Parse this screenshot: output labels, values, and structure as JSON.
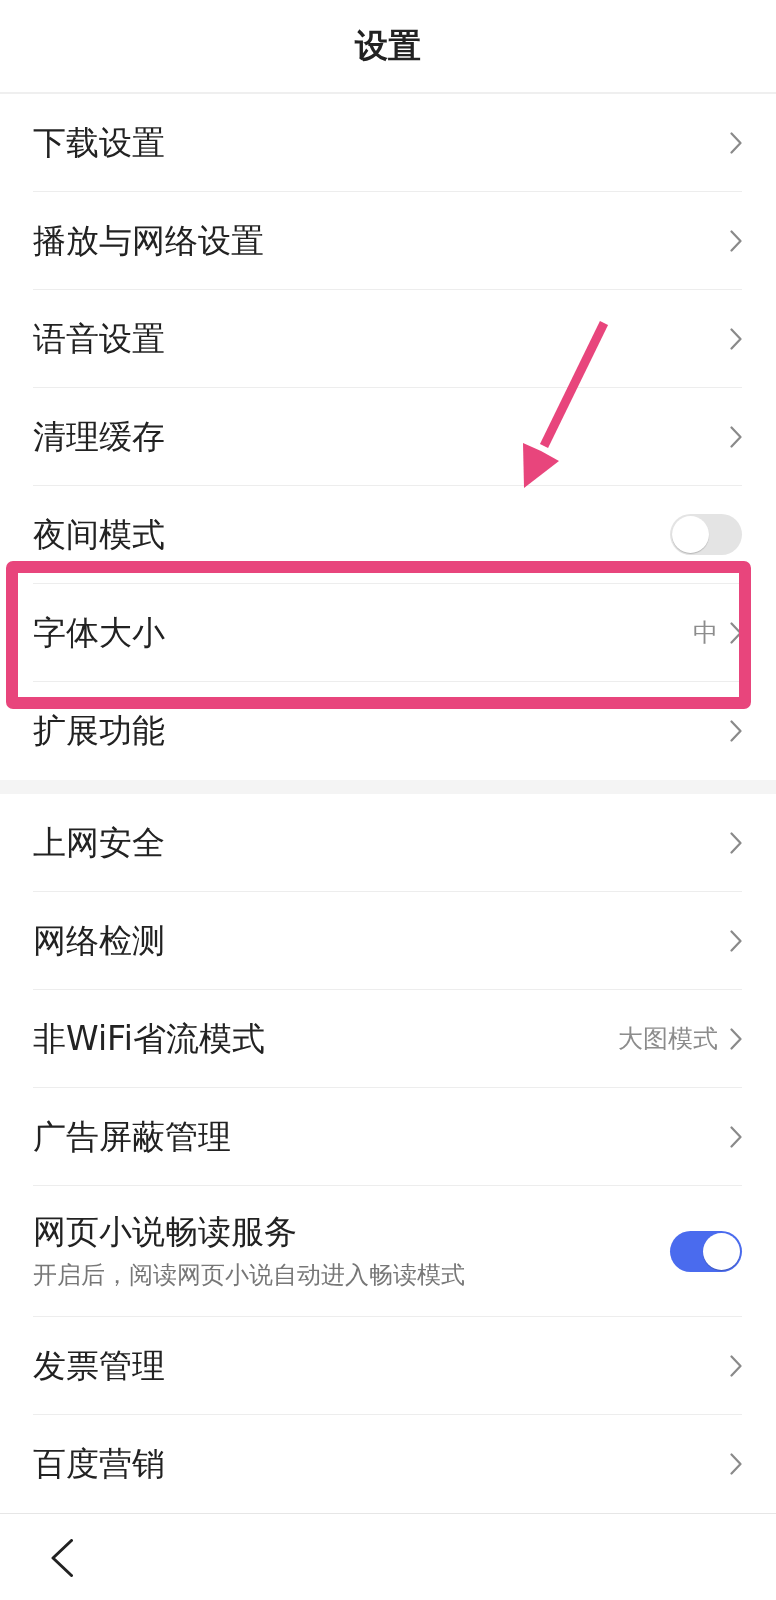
{
  "header": {
    "title": "设置"
  },
  "sections": [
    {
      "items": [
        {
          "kind": "link",
          "label": "下载设置"
        },
        {
          "kind": "link",
          "label": "播放与网络设置"
        },
        {
          "kind": "link",
          "label": "语音设置"
        },
        {
          "kind": "link",
          "label": "清理缓存"
        },
        {
          "kind": "toggle",
          "label": "夜间模式",
          "on": false
        },
        {
          "kind": "link",
          "label": "字体大小",
          "value": "中",
          "highlighted": true
        },
        {
          "kind": "link",
          "label": "扩展功能"
        }
      ]
    },
    {
      "items": [
        {
          "kind": "link",
          "label": "上网安全"
        },
        {
          "kind": "link",
          "label": "网络检测"
        },
        {
          "kind": "link",
          "label": "非WiFi省流模式",
          "value": "大图模式"
        },
        {
          "kind": "link",
          "label": "广告屏蔽管理"
        },
        {
          "kind": "toggle",
          "label": "网页小说畅读服务",
          "description": "开启后，阅读网页小说自动进入畅读模式",
          "on": true
        },
        {
          "kind": "link",
          "label": "发票管理"
        },
        {
          "kind": "link",
          "label": "百度营销"
        }
      ]
    }
  ],
  "annotations": [
    {
      "kind": "arrow"
    }
  ]
}
